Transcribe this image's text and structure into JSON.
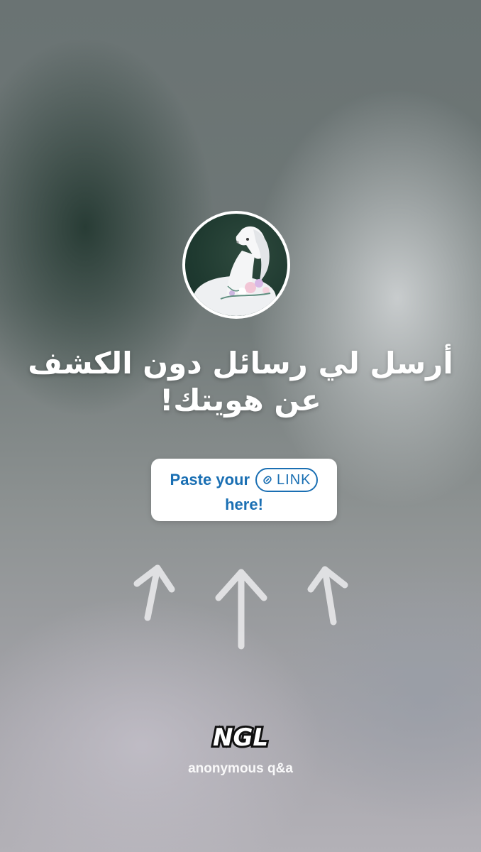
{
  "profile": {
    "avatar_icon": "white-horse-photo"
  },
  "headline": {
    "text": "أرسل لي رسائل دون الكشف عن هويتك!"
  },
  "paste_card": {
    "line1": "Paste your",
    "link_label": "LINK",
    "line2": "here!",
    "link_icon": "chain-link-icon",
    "color": "#1a6fb3"
  },
  "arrows": {
    "count": 3,
    "icon": "arrow-up-icon",
    "color": "#e8e8ea"
  },
  "brand": {
    "logo": "NGL",
    "tagline": "anonymous q&a"
  }
}
